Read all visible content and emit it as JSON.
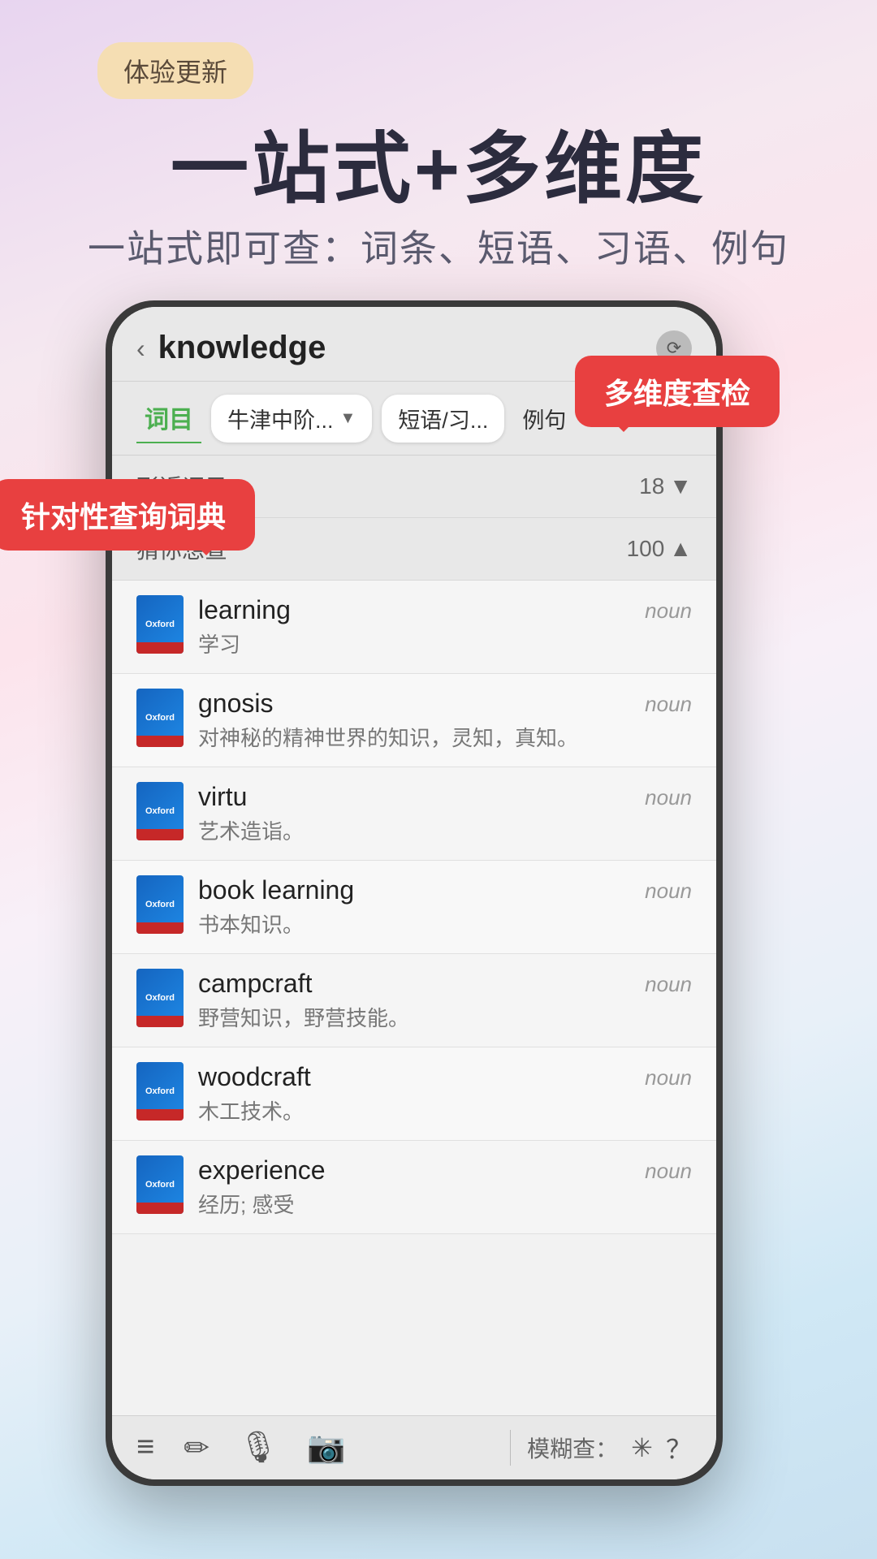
{
  "badge": "体验更新",
  "headline": "一站式+多维度",
  "subheadline": "一站式即可查：词条、短语、习语、例句",
  "tooltip_multidim": "多维度查检",
  "tooltip_query": "针对性查询词典",
  "phone": {
    "search_word": "knowledge",
    "tabs": {
      "active": "词目",
      "dropdown": "牛津中阶...",
      "tab2": "短语/习...",
      "tab3": "例句"
    },
    "sections": {
      "related": {
        "label": "形近词目",
        "count": "18",
        "icon": "▼"
      },
      "guess": {
        "label": "猜你想查",
        "count": "100",
        "icon": "▲"
      }
    },
    "words": [
      {
        "word": "learning",
        "pos": "noun",
        "zh": "学习"
      },
      {
        "word": "gnosis",
        "pos": "noun",
        "zh": "对神秘的精神世界的知识，灵知，真知。"
      },
      {
        "word": "virtu",
        "pos": "noun",
        "zh": "艺术造诣。"
      },
      {
        "word": "book learning",
        "pos": "noun",
        "zh": "书本知识。"
      },
      {
        "word": "campcraft",
        "pos": "noun",
        "zh": "野营知识，野营技能。"
      },
      {
        "word": "woodcraft",
        "pos": "noun",
        "zh": "木工技术。"
      },
      {
        "word": "experience",
        "pos": "noun",
        "zh": "经历; 感受"
      }
    ],
    "toolbar": {
      "fuzzy_label": "模糊查：",
      "icons": [
        "≡≡≡",
        "✏",
        "🎤",
        "📷",
        "＊",
        "？"
      ]
    }
  }
}
